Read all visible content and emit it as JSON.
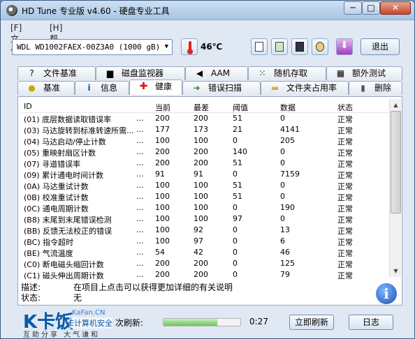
{
  "window": {
    "title": "HD Tune 专业版 v4.60 - 硬盘专业工具",
    "minimize": "─",
    "maximize": "□",
    "close": "✕"
  },
  "menu": {
    "file": "[F]文件",
    "help": "[H]帮助"
  },
  "toolbar": {
    "drive": "WDL WD1002FAEX-00Z3A0 (1000 gB)",
    "temperature": "46℃",
    "exit": "退出"
  },
  "tabs_top": [
    {
      "label": "文件基准",
      "icon": "?"
    },
    {
      "label": "磁盘监视器",
      "icon": "▆"
    },
    {
      "label": "AAM",
      "icon": "◀"
    },
    {
      "label": "随机存取",
      "icon": "⁙"
    },
    {
      "label": "额外测试",
      "icon": "▦"
    }
  ],
  "tabs_bottom": [
    {
      "label": "基准",
      "icon": "●"
    },
    {
      "label": "信息",
      "icon": "i"
    },
    {
      "label": "健康",
      "icon": "✚"
    },
    {
      "label": "错误扫描",
      "icon": "➜"
    },
    {
      "label": "文件夹占用率",
      "icon": "▬"
    },
    {
      "label": "删除",
      "icon": "▮"
    }
  ],
  "table": {
    "headers": {
      "id": "ID",
      "current": "当前",
      "worst": "最差",
      "threshold": "阈值",
      "data": "数据",
      "status": "状态"
    },
    "rows": [
      {
        "id": "(01) 底层数据读取错误率",
        "dots": "...",
        "current": "200",
        "worst": "200",
        "threshold": "51",
        "data": "0",
        "status": "正常"
      },
      {
        "id": "(03) 马达旋转到标准转速所需...",
        "dots": "...",
        "current": "177",
        "worst": "173",
        "threshold": "21",
        "data": "4141",
        "status": "正常"
      },
      {
        "id": "(04) 马达启动/停止计数",
        "dots": "...",
        "current": "100",
        "worst": "100",
        "threshold": "0",
        "data": "205",
        "status": "正常"
      },
      {
        "id": "(05) 重映射扇区计数",
        "dots": "...",
        "current": "200",
        "worst": "200",
        "threshold": "140",
        "data": "0",
        "status": "正常"
      },
      {
        "id": "(07) 寻道错误率",
        "dots": "...",
        "current": "200",
        "worst": "200",
        "threshold": "51",
        "data": "0",
        "status": "正常"
      },
      {
        "id": "(09) 累计通电时间计数",
        "dots": "...",
        "current": "91",
        "worst": "91",
        "threshold": "0",
        "data": "7159",
        "status": "正常"
      },
      {
        "id": "(0A) 马达重试计数",
        "dots": "...",
        "current": "100",
        "worst": "100",
        "threshold": "51",
        "data": "0",
        "status": "正常"
      },
      {
        "id": "(0B) 校准重试计数",
        "dots": "...",
        "current": "100",
        "worst": "100",
        "threshold": "51",
        "data": "0",
        "status": "正常"
      },
      {
        "id": "(0C) 通电周期计数",
        "dots": "...",
        "current": "100",
        "worst": "100",
        "threshold": "0",
        "data": "190",
        "status": "正常"
      },
      {
        "id": "(B8) 末尾到末尾错误检测",
        "dots": "...",
        "current": "100",
        "worst": "100",
        "threshold": "97",
        "data": "0",
        "status": "正常"
      },
      {
        "id": "(BB) 反馈无法校正的错误",
        "dots": "...",
        "current": "100",
        "worst": "92",
        "threshold": "0",
        "data": "13",
        "status": "正常"
      },
      {
        "id": "(BC) 指令超时",
        "dots": "...",
        "current": "100",
        "worst": "97",
        "threshold": "0",
        "data": "6",
        "status": "正常"
      },
      {
        "id": "(BE) 气流温度",
        "dots": "...",
        "current": "54",
        "worst": "42",
        "threshold": "0",
        "data": "46",
        "status": "正常"
      },
      {
        "id": "(C0) 断电磁头缩回计数",
        "dots": "...",
        "current": "200",
        "worst": "200",
        "threshold": "0",
        "data": "125",
        "status": "正常"
      },
      {
        "id": "(C1) 磁头伸出周期计数",
        "dots": "...",
        "current": "200",
        "worst": "200",
        "threshold": "0",
        "data": "79",
        "status": "正常"
      }
    ]
  },
  "description": {
    "label": "描述:",
    "text": "在项目上点击可以获得更加详细的有关说明",
    "status_label": "状态:",
    "status_text": "无"
  },
  "bottom": {
    "autorefresh_label": "次刷新:",
    "progress": 0.7,
    "timer": "0:27",
    "refresh_button": "立即刷新",
    "log_button": "日志"
  },
  "watermark": {
    "mark": "K卡饭",
    "site": "KaFan.CN",
    "cn": "E计算机安全",
    "slogan": "互助分享  大气谦和"
  }
}
